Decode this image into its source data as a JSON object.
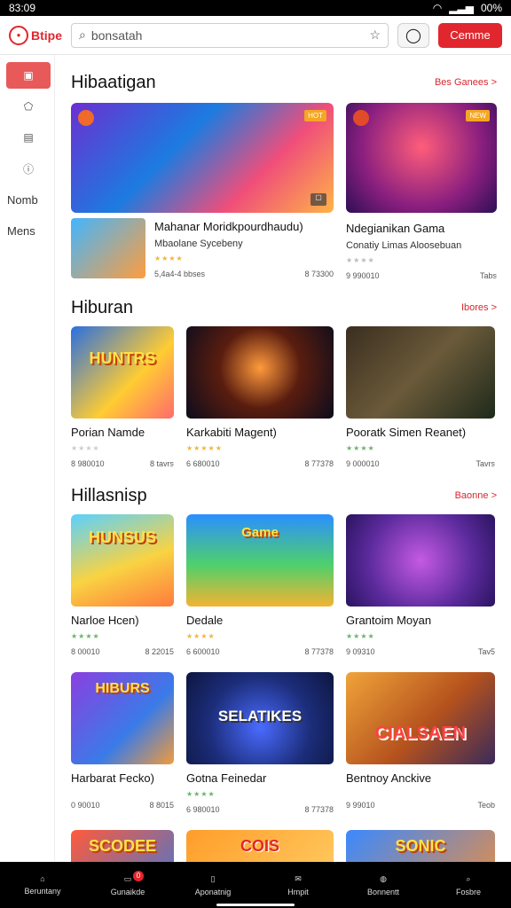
{
  "status_bar": {
    "time": "83:09",
    "battery": "00%"
  },
  "header": {
    "logo_text": "Btipe",
    "search_placeholder": "bonsatah",
    "cta_label": "Cemme"
  },
  "sidebar": {
    "items": [
      "Nomb",
      "Mens"
    ]
  },
  "sections": [
    {
      "title": "Hibaatigan",
      "more_label": "Bes Ganees >",
      "featured": [
        {
          "title": "Mahanar Moridkpourdhaudu)",
          "subtitle": "Mbaolane Sycebeny",
          "rating_text": "5,4a4-4 bbses",
          "meta_right": "8 73300",
          "tag": "HOT"
        },
        {
          "title": "Ndegianikan Gama",
          "subtitle": "Conatiy Limas Aloosebuan",
          "rating_text": "9 990010",
          "meta_right": "Tabs",
          "tag": "NEW"
        }
      ]
    },
    {
      "title": "Hiburan",
      "more_label": "Ibores >",
      "cards": [
        {
          "title": "Porian Namde",
          "meta_left": "8 980010",
          "meta_right": "8 tavrs"
        },
        {
          "title": "Karkabiti Magent)",
          "meta_left": "6 680010",
          "meta_right": "8 77378"
        },
        {
          "title": "Pooratk Simen Reanet)",
          "meta_left": "9 000010",
          "meta_right": "Tavrs"
        }
      ]
    },
    {
      "title": "Hillasnisp",
      "more_label": "Baonne >",
      "cards": [
        {
          "title": "Narloe Hcen)",
          "meta_left": "8 00010",
          "meta_right": "8 22015"
        },
        {
          "title": "Dedale",
          "meta_left": "6 600010",
          "meta_right": "8 77378"
        },
        {
          "title": "Grantoim Moyan",
          "meta_left": "9 09310",
          "meta_right": "Tav5"
        },
        {
          "title": "Harbarat Fecko)",
          "meta_left": "0 90010",
          "meta_right": "8 8015"
        },
        {
          "title": "Gotna Feinedar",
          "meta_left": "6 980010",
          "meta_right": "8 77378"
        },
        {
          "title": "Bentnoy Anckive",
          "meta_left": "9 99010",
          "meta_right": "Teob"
        }
      ]
    }
  ],
  "image_texts": {
    "a": "HUNTRS",
    "b": "HUNSUS",
    "c": "Game",
    "d": "HIBURS",
    "e": "SELATIKES",
    "f": "CIALSAEN",
    "g": "SCODEE",
    "h": "COIS",
    "i": "SONIC"
  },
  "bottom_nav": [
    {
      "label": "Beruntany"
    },
    {
      "label": "Gunaikde",
      "badge": "0"
    },
    {
      "label": "Aponatnig"
    },
    {
      "label": "Hmpit"
    },
    {
      "label": "Bonnentt"
    },
    {
      "label": "Fosbre"
    }
  ]
}
